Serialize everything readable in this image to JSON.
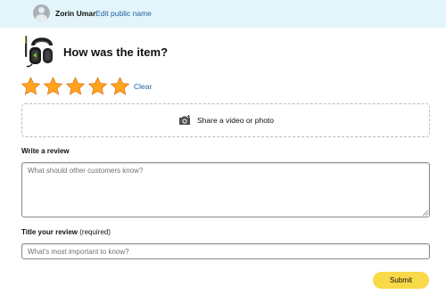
{
  "header": {
    "user_name": "Zorin Umar",
    "edit_link": "Edit public name",
    "background_color": "#e3f4fa",
    "avatar_icon": "user-silhouette-icon"
  },
  "product": {
    "image_icon": "headset-product-image",
    "question": "How was the item?"
  },
  "rating": {
    "stars_filled": 5,
    "stars_total": 5,
    "star_color": "#ffa41c",
    "clear_label": "Clear"
  },
  "media": {
    "icon": "camera-plus-icon",
    "label": "Share a video or photo"
  },
  "review": {
    "label": "Write a review",
    "placeholder": "What should other customers know?",
    "value": ""
  },
  "title": {
    "label": "Title your review",
    "label_suffix": "(required)",
    "placeholder": "What's most important to know?",
    "value": ""
  },
  "submit": {
    "label": "Submit",
    "color": "#f7d949"
  },
  "link_color": "#2162a1"
}
